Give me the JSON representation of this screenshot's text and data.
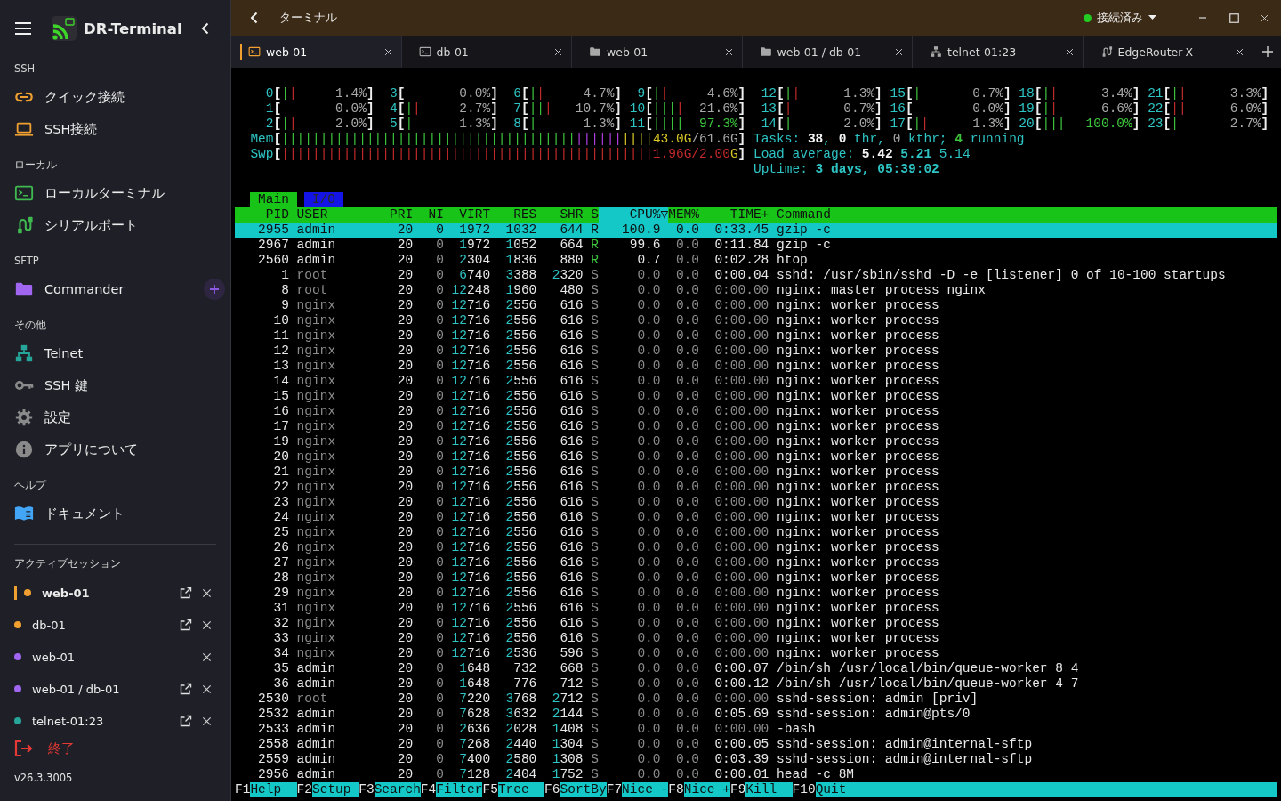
{
  "sidebar": {
    "app_name": "DR-Terminal",
    "sections": [
      {
        "heading": "SSH",
        "items": [
          {
            "label": "クイック接続",
            "kind": "quick"
          },
          {
            "label": "SSH接続",
            "kind": "ssh"
          }
        ]
      },
      {
        "heading": "ローカル",
        "items": [
          {
            "label": "ローカルターミナル",
            "kind": "local"
          },
          {
            "label": "シリアルポート",
            "kind": "serial"
          }
        ]
      },
      {
        "heading": "SFTP",
        "items": [
          {
            "label": "Commander",
            "kind": "sftp",
            "add_button": true
          }
        ]
      },
      {
        "heading": "その他",
        "items": [
          {
            "label": "Telnet",
            "kind": "telnet"
          },
          {
            "label": "SSH 鍵",
            "kind": "keys"
          },
          {
            "label": "設定",
            "kind": "settings"
          },
          {
            "label": "アプリについて",
            "kind": "about"
          }
        ]
      },
      {
        "heading": "ヘルプ",
        "items": [
          {
            "label": "ドキュメント",
            "kind": "docs"
          }
        ]
      }
    ],
    "sessions_heading": "アクティブセッション",
    "sessions": [
      {
        "label": "web-01",
        "color": "#f0a030",
        "selected": true,
        "popout": true
      },
      {
        "label": "db-01",
        "color": "#f0a030",
        "selected": false,
        "popout": true
      },
      {
        "label": "web-01",
        "color": "#a066f0",
        "selected": false,
        "popout": false
      },
      {
        "label": "web-01 / db-01",
        "color": "#a066f0",
        "selected": false,
        "popout": true
      },
      {
        "label": "telnet-01:23",
        "color": "#26a69a",
        "selected": false,
        "popout": true
      }
    ],
    "exit": "終了",
    "version": "v26.3.3005"
  },
  "titlebar": {
    "title": "ターミナル",
    "status": {
      "label": "接続済み",
      "connected": true
    }
  },
  "tabs": [
    {
      "label": "web-01",
      "kind": "ssh",
      "selected": true
    },
    {
      "label": "db-01",
      "kind": "ssh",
      "selected": false
    },
    {
      "label": "web-01",
      "kind": "sftp",
      "selected": false
    },
    {
      "label": "web-01 / db-01",
      "kind": "sftp",
      "selected": false
    },
    {
      "label": "telnet-01:23",
      "kind": "telnet",
      "selected": false
    },
    {
      "label": "EdgeRouter-X",
      "kind": "serial",
      "selected": false
    }
  ],
  "terminal": {
    "left_cpus": [
      {
        "label": "0",
        "open": "[",
        "bar": [
          {
            "kind": "user",
            "text": "|"
          },
          {
            "kind": "kernel",
            "text": "|"
          }
        ],
        "value": [
          {
            "kind": "dim",
            "text": "1.4%"
          }
        ],
        "close": "]"
      },
      {
        "label": "1",
        "open": "[",
        "value": [
          {
            "kind": "dim",
            "text": "0.0%"
          }
        ],
        "close": "]"
      },
      {
        "label": "2",
        "open": "[",
        "bar": [
          {
            "kind": "user",
            "text": "|"
          },
          {
            "kind": "kernel",
            "text": "|"
          }
        ],
        "value": [
          {
            "kind": "dim",
            "text": "2.0%"
          }
        ],
        "close": "]"
      },
      {
        "label": "3",
        "open": "[",
        "value": [
          {
            "kind": "dim",
            "text": "0.0%"
          }
        ],
        "close": "]"
      },
      {
        "label": "4",
        "open": "[",
        "bar": [
          {
            "kind": "user",
            "text": "|"
          },
          {
            "kind": "kernel",
            "text": "|"
          }
        ],
        "value": [
          {
            "kind": "dim",
            "text": "2.7%"
          }
        ],
        "close": "]"
      },
      {
        "label": "5",
        "open": "[",
        "bar": [
          {
            "kind": "user",
            "text": "|"
          }
        ],
        "value": [
          {
            "kind": "dim",
            "text": "1.3%"
          }
        ],
        "close": "]"
      },
      {
        "label": "6",
        "open": "[",
        "bar": [
          {
            "kind": "user",
            "text": "|"
          },
          {
            "kind": "kernel",
            "text": "|"
          }
        ],
        "value": [
          {
            "kind": "dim",
            "text": "4.7%"
          }
        ],
        "close": "]"
      },
      {
        "label": "7",
        "open": "[",
        "bar": [
          {
            "kind": "user",
            "text": "||"
          },
          {
            "kind": "kernel",
            "text": "|"
          }
        ],
        "value": [
          {
            "kind": "dim",
            "text": "10.7%"
          }
        ],
        "close": "]"
      },
      {
        "label": "8",
        "open": "[",
        "bar": [
          {
            "kind": "user",
            "text": "|"
          }
        ],
        "value": [
          {
            "kind": "dim",
            "text": "1.3%"
          }
        ],
        "close": "]"
      },
      {
        "label": "9",
        "open": "[",
        "bar": [
          {
            "kind": "user",
            "text": "|"
          },
          {
            "kind": "kernel",
            "text": "|"
          }
        ],
        "value": [
          {
            "kind": "dim",
            "text": "4.6%"
          }
        ],
        "close": "]"
      },
      {
        "label": "10",
        "open": "[",
        "bar": [
          {
            "kind": "user",
            "text": "|||"
          },
          {
            "kind": "kernel",
            "text": "|"
          }
        ],
        "value": [
          {
            "kind": "dim",
            "text": "21.6%"
          }
        ],
        "close": "]"
      },
      {
        "label": "11",
        "open": "[",
        "bar": [
          {
            "kind": "user",
            "text": "||||"
          }
        ],
        "value": [
          {
            "kind": "user",
            "text": "97.3%"
          }
        ],
        "close": "]"
      }
    ],
    "right_cpus": [
      {
        "label": "12",
        "open": "[",
        "bar": [
          {
            "kind": "user",
            "text": "|"
          },
          {
            "kind": "kernel",
            "text": "|"
          }
        ],
        "value": [
          {
            "kind": "dim",
            "text": "1.3%"
          }
        ],
        "close": "]"
      },
      {
        "label": "13",
        "open": "[",
        "bar": [
          {
            "kind": "kernel",
            "text": "|"
          }
        ],
        "value": [
          {
            "kind": "dim",
            "text": "0.7%"
          }
        ],
        "close": "]"
      },
      {
        "label": "14",
        "open": "[",
        "bar": [
          {
            "kind": "user",
            "text": "|"
          }
        ],
        "value": [
          {
            "kind": "dim",
            "text": "2.0%"
          }
        ],
        "close": "]"
      },
      {
        "label": "15",
        "open": "[",
        "bar": [
          {
            "kind": "user",
            "text": "|"
          }
        ],
        "value": [
          {
            "kind": "dim",
            "text": "0.7%"
          }
        ],
        "close": "]"
      },
      {
        "label": "16",
        "open": "[",
        "value": [
          {
            "kind": "dim",
            "text": "0.0%"
          }
        ],
        "close": "]"
      },
      {
        "label": "17",
        "open": "[",
        "bar": [
          {
            "kind": "user",
            "text": "|"
          },
          {
            "kind": "kernel",
            "text": "|"
          }
        ],
        "value": [
          {
            "kind": "dim",
            "text": "1.3%"
          }
        ],
        "close": "]"
      },
      {
        "label": "18",
        "open": "[",
        "bar": [
          {
            "kind": "user",
            "text": "|"
          },
          {
            "kind": "kernel",
            "text": "|"
          }
        ],
        "value": [
          {
            "kind": "dim",
            "text": "3.4%"
          }
        ],
        "close": "]"
      },
      {
        "label": "19",
        "open": "[",
        "bar": [
          {
            "kind": "user",
            "text": "|"
          },
          {
            "kind": "kernel",
            "text": "|"
          }
        ],
        "value": [
          {
            "kind": "dim",
            "text": "6.6%"
          }
        ],
        "close": "]"
      },
      {
        "label": "20",
        "open": "[",
        "bar": [
          {
            "kind": "user",
            "text": "|||"
          }
        ],
        "value": [
          {
            "kind": "user",
            "text": "100.0%"
          }
        ],
        "close": "]"
      },
      {
        "label": "21",
        "open": "[",
        "bar": [
          {
            "kind": "user",
            "text": "|"
          },
          {
            "kind": "kernel",
            "text": "|"
          }
        ],
        "value": [
          {
            "kind": "dim",
            "text": "3.3%"
          }
        ],
        "close": "]"
      },
      {
        "label": "22",
        "open": "[",
        "bar": [
          {
            "kind": "kernel",
            "text": "||"
          }
        ],
        "value": [
          {
            "kind": "dim",
            "text": "6.0%"
          }
        ],
        "close": "]"
      },
      {
        "label": "23",
        "open": "[",
        "bar": [
          {
            "kind": "user",
            "text": "|"
          }
        ],
        "value": [
          {
            "kind": "dim",
            "text": "2.7%"
          }
        ],
        "close": "]"
      }
    ],
    "left_meters": [
      {
        "label": "Mem",
        "open": "[",
        "bar": [
          {
            "kind": "user",
            "text": "||||||||||||||||||||||||||||||||||||||"
          },
          {
            "kind": "buffers",
            "text": "||||||"
          },
          {
            "kind": "cache",
            "text": "||||"
          }
        ],
        "value": [
          {
            "kind": "cache",
            "text": "43.0G"
          },
          {
            "kind": "dim",
            "text": "/61.6G"
          }
        ],
        "close": "]"
      },
      {
        "label": "Swp",
        "open": "[",
        "bar": [
          {
            "kind": "swap",
            "text": "||||||||||||||||||||||||||||||||||||||||||||||||"
          }
        ],
        "value": [
          {
            "kind": "swap",
            "text": "1.96G/2.00"
          },
          {
            "kind": "cache",
            "text": "G"
          }
        ],
        "close": "]"
      }
    ],
    "right_lines": [
      [
        {
          "kind": "info",
          "text": "Tasks: "
        },
        {
          "kind": "strong",
          "text": "38"
        },
        {
          "kind": "info",
          "text": ", "
        },
        {
          "kind": "strong",
          "text": "0"
        },
        {
          "kind": "info",
          "text": " thr, "
        },
        {
          "kind": "faint",
          "text": "0"
        },
        {
          "kind": "info",
          "text": " kthr; "
        },
        {
          "kind": "ok",
          "text": "4"
        },
        {
          "kind": "info",
          "text": " running"
        }
      ],
      [
        {
          "kind": "info",
          "text": "Load average: "
        },
        {
          "kind": "strong",
          "text": "5.42 "
        },
        {
          "kind": "info_bold",
          "text": "5.21 "
        },
        {
          "kind": "info",
          "text": "5.14"
        }
      ],
      [
        {
          "kind": "info",
          "text": "Uptime: "
        },
        {
          "kind": "info_bold",
          "text": "3 days, 05:39:02"
        }
      ]
    ],
    "screens": [
      {
        "label": "Main",
        "selected": true
      },
      {
        "label": "I/O",
        "selected": false
      }
    ],
    "columns": [
      {
        "label": "PID",
        "sorted": false
      },
      {
        "label": "USER",
        "sorted": false
      },
      {
        "label": "PRI",
        "sorted": false
      },
      {
        "label": "NI",
        "sorted": false
      },
      {
        "label": "VIRT",
        "sorted": false
      },
      {
        "label": "RES",
        "sorted": false
      },
      {
        "label": "SHR",
        "sorted": false
      },
      {
        "label": "S",
        "sorted": false
      },
      {
        "label": "CPU%▽",
        "sorted": true
      },
      {
        "label": "MEM%",
        "sorted": false
      },
      {
        "label": "TIME+",
        "sorted": false
      },
      {
        "label": "Command",
        "sorted": false
      }
    ],
    "rows": [
      {
        "pid": "2955",
        "user": "admin",
        "pri": "20",
        "ni": "0",
        "virt": "1972",
        "res": "1032",
        "shr": "644",
        "s": "R",
        "cpu": "100.9",
        "mem": "0.0",
        "time": "0:33.45",
        "command": "gzip -c",
        "selected": true
      },
      {
        "pid": "2967",
        "user": "admin",
        "pri": "20",
        "ni": "0",
        "virt": "1972",
        "res": "1052",
        "shr": "664",
        "s": "R",
        "cpu": "99.6",
        "mem": "0.0",
        "time": "0:11.84",
        "command": "gzip -c",
        "selected": false,
        "own": true,
        "running": true,
        "cpu_idle": false,
        "time_idle": false
      },
      {
        "pid": "2560",
        "user": "admin",
        "pri": "20",
        "ni": "0",
        "virt": "2304",
        "res": "1836",
        "shr": "880",
        "s": "R",
        "cpu": "0.7",
        "mem": "0.0",
        "time": "0:02.28",
        "command": "htop",
        "selected": false,
        "own": true,
        "running": true,
        "cpu_idle": false,
        "time_idle": false
      },
      {
        "pid": "1",
        "user": "root",
        "pri": "20",
        "ni": "0",
        "virt": "6740",
        "res": "3388",
        "shr": "2320",
        "s": "S",
        "cpu": "0.0",
        "mem": "0.0",
        "time": "0:00.04",
        "command": "sshd: /usr/sbin/sshd -D -e [listener] 0 of 10-100 startups",
        "selected": false,
        "own": false,
        "running": false,
        "cpu_idle": true,
        "time_idle": false
      },
      {
        "pid": "8",
        "user": "root",
        "pri": "20",
        "ni": "0",
        "virt": "12248",
        "res": "1960",
        "shr": "480",
        "s": "S",
        "cpu": "0.0",
        "mem": "0.0",
        "time": "0:00.00",
        "command": "nginx: master process nginx",
        "selected": false,
        "own": false,
        "running": false,
        "cpu_idle": true,
        "time_idle": true
      },
      {
        "pid": "9",
        "user": "nginx",
        "pri": "20",
        "ni": "0",
        "virt": "12716",
        "res": "2556",
        "shr": "616",
        "s": "S",
        "cpu": "0.0",
        "mem": "0.0",
        "time": "0:00.00",
        "command": "nginx: worker process",
        "selected": false,
        "own": false,
        "running": false,
        "cpu_idle": true,
        "time_idle": true
      },
      {
        "pid": "10",
        "user": "nginx",
        "pri": "20",
        "ni": "0",
        "virt": "12716",
        "res": "2556",
        "shr": "616",
        "s": "S",
        "cpu": "0.0",
        "mem": "0.0",
        "time": "0:00.00",
        "command": "nginx: worker process",
        "selected": false,
        "own": false,
        "running": false,
        "cpu_idle": true,
        "time_idle": true
      },
      {
        "pid": "11",
        "user": "nginx",
        "pri": "20",
        "ni": "0",
        "virt": "12716",
        "res": "2556",
        "shr": "616",
        "s": "S",
        "cpu": "0.0",
        "mem": "0.0",
        "time": "0:00.00",
        "command": "nginx: worker process",
        "selected": false,
        "own": false,
        "running": false,
        "cpu_idle": true,
        "time_idle": true
      },
      {
        "pid": "12",
        "user": "nginx",
        "pri": "20",
        "ni": "0",
        "virt": "12716",
        "res": "2556",
        "shr": "616",
        "s": "S",
        "cpu": "0.0",
        "mem": "0.0",
        "time": "0:00.00",
        "command": "nginx: worker process",
        "selected": false,
        "own": false,
        "running": false,
        "cpu_idle": true,
        "time_idle": true
      },
      {
        "pid": "13",
        "user": "nginx",
        "pri": "20",
        "ni": "0",
        "virt": "12716",
        "res": "2556",
        "shr": "616",
        "s": "S",
        "cpu": "0.0",
        "mem": "0.0",
        "time": "0:00.00",
        "command": "nginx: worker process",
        "selected": false,
        "own": false,
        "running": false,
        "cpu_idle": true,
        "time_idle": true
      },
      {
        "pid": "14",
        "user": "nginx",
        "pri": "20",
        "ni": "0",
        "virt": "12716",
        "res": "2556",
        "shr": "616",
        "s": "S",
        "cpu": "0.0",
        "mem": "0.0",
        "time": "0:00.00",
        "command": "nginx: worker process",
        "selected": false,
        "own": false,
        "running": false,
        "cpu_idle": true,
        "time_idle": true
      },
      {
        "pid": "15",
        "user": "nginx",
        "pri": "20",
        "ni": "0",
        "virt": "12716",
        "res": "2556",
        "shr": "616",
        "s": "S",
        "cpu": "0.0",
        "mem": "0.0",
        "time": "0:00.00",
        "command": "nginx: worker process",
        "selected": false,
        "own": false,
        "running": false,
        "cpu_idle": true,
        "time_idle": true
      },
      {
        "pid": "16",
        "user": "nginx",
        "pri": "20",
        "ni": "0",
        "virt": "12716",
        "res": "2556",
        "shr": "616",
        "s": "S",
        "cpu": "0.0",
        "mem": "0.0",
        "time": "0:00.00",
        "command": "nginx: worker process",
        "selected": false,
        "own": false,
        "running": false,
        "cpu_idle": true,
        "time_idle": true
      },
      {
        "pid": "17",
        "user": "nginx",
        "pri": "20",
        "ni": "0",
        "virt": "12716",
        "res": "2556",
        "shr": "616",
        "s": "S",
        "cpu": "0.0",
        "mem": "0.0",
        "time": "0:00.00",
        "command": "nginx: worker process",
        "selected": false,
        "own": false,
        "running": false,
        "cpu_idle": true,
        "time_idle": true
      },
      {
        "pid": "19",
        "user": "nginx",
        "pri": "20",
        "ni": "0",
        "virt": "12716",
        "res": "2556",
        "shr": "616",
        "s": "S",
        "cpu": "0.0",
        "mem": "0.0",
        "time": "0:00.00",
        "command": "nginx: worker process",
        "selected": false,
        "own": false,
        "running": false,
        "cpu_idle": true,
        "time_idle": true
      },
      {
        "pid": "20",
        "user": "nginx",
        "pri": "20",
        "ni": "0",
        "virt": "12716",
        "res": "2556",
        "shr": "616",
        "s": "S",
        "cpu": "0.0",
        "mem": "0.0",
        "time": "0:00.00",
        "command": "nginx: worker process",
        "selected": false,
        "own": false,
        "running": false,
        "cpu_idle": true,
        "time_idle": true
      },
      {
        "pid": "21",
        "user": "nginx",
        "pri": "20",
        "ni": "0",
        "virt": "12716",
        "res": "2556",
        "shr": "616",
        "s": "S",
        "cpu": "0.0",
        "mem": "0.0",
        "time": "0:00.00",
        "command": "nginx: worker process",
        "selected": false,
        "own": false,
        "running": false,
        "cpu_idle": true,
        "time_idle": true
      },
      {
        "pid": "22",
        "user": "nginx",
        "pri": "20",
        "ni": "0",
        "virt": "12716",
        "res": "2556",
        "shr": "616",
        "s": "S",
        "cpu": "0.0",
        "mem": "0.0",
        "time": "0:00.00",
        "command": "nginx: worker process",
        "selected": false,
        "own": false,
        "running": false,
        "cpu_idle": true,
        "time_idle": true
      },
      {
        "pid": "23",
        "user": "nginx",
        "pri": "20",
        "ni": "0",
        "virt": "12716",
        "res": "2556",
        "shr": "616",
        "s": "S",
        "cpu": "0.0",
        "mem": "0.0",
        "time": "0:00.00",
        "command": "nginx: worker process",
        "selected": false,
        "own": false,
        "running": false,
        "cpu_idle": true,
        "time_idle": true
      },
      {
        "pid": "24",
        "user": "nginx",
        "pri": "20",
        "ni": "0",
        "virt": "12716",
        "res": "2556",
        "shr": "616",
        "s": "S",
        "cpu": "0.0",
        "mem": "0.0",
        "time": "0:00.00",
        "command": "nginx: worker process",
        "selected": false,
        "own": false,
        "running": false,
        "cpu_idle": true,
        "time_idle": true
      },
      {
        "pid": "25",
        "user": "nginx",
        "pri": "20",
        "ni": "0",
        "virt": "12716",
        "res": "2556",
        "shr": "616",
        "s": "S",
        "cpu": "0.0",
        "mem": "0.0",
        "time": "0:00.00",
        "command": "nginx: worker process",
        "selected": false,
        "own": false,
        "running": false,
        "cpu_idle": true,
        "time_idle": true
      },
      {
        "pid": "26",
        "user": "nginx",
        "pri": "20",
        "ni": "0",
        "virt": "12716",
        "res": "2556",
        "shr": "616",
        "s": "S",
        "cpu": "0.0",
        "mem": "0.0",
        "time": "0:00.00",
        "command": "nginx: worker process",
        "selected": false,
        "own": false,
        "running": false,
        "cpu_idle": true,
        "time_idle": true
      },
      {
        "pid": "27",
        "user": "nginx",
        "pri": "20",
        "ni": "0",
        "virt": "12716",
        "res": "2556",
        "shr": "616",
        "s": "S",
        "cpu": "0.0",
        "mem": "0.0",
        "time": "0:00.00",
        "command": "nginx: worker process",
        "selected": false,
        "own": false,
        "running": false,
        "cpu_idle": true,
        "time_idle": true
      },
      {
        "pid": "28",
        "user": "nginx",
        "pri": "20",
        "ni": "0",
        "virt": "12716",
        "res": "2556",
        "shr": "616",
        "s": "S",
        "cpu": "0.0",
        "mem": "0.0",
        "time": "0:00.00",
        "command": "nginx: worker process",
        "selected": false,
        "own": false,
        "running": false,
        "cpu_idle": true,
        "time_idle": true
      },
      {
        "pid": "29",
        "user": "nginx",
        "pri": "20",
        "ni": "0",
        "virt": "12716",
        "res": "2556",
        "shr": "616",
        "s": "S",
        "cpu": "0.0",
        "mem": "0.0",
        "time": "0:00.00",
        "command": "nginx: worker process",
        "selected": false,
        "own": false,
        "running": false,
        "cpu_idle": true,
        "time_idle": true
      },
      {
        "pid": "31",
        "user": "nginx",
        "pri": "20",
        "ni": "0",
        "virt": "12716",
        "res": "2556",
        "shr": "616",
        "s": "S",
        "cpu": "0.0",
        "mem": "0.0",
        "time": "0:00.00",
        "command": "nginx: worker process",
        "selected": false,
        "own": false,
        "running": false,
        "cpu_idle": true,
        "time_idle": true
      },
      {
        "pid": "32",
        "user": "nginx",
        "pri": "20",
        "ni": "0",
        "virt": "12716",
        "res": "2556",
        "shr": "616",
        "s": "S",
        "cpu": "0.0",
        "mem": "0.0",
        "time": "0:00.00",
        "command": "nginx: worker process",
        "selected": false,
        "own": false,
        "running": false,
        "cpu_idle": true,
        "time_idle": true
      },
      {
        "pid": "33",
        "user": "nginx",
        "pri": "20",
        "ni": "0",
        "virt": "12716",
        "res": "2556",
        "shr": "616",
        "s": "S",
        "cpu": "0.0",
        "mem": "0.0",
        "time": "0:00.00",
        "command": "nginx: worker process",
        "selected": false,
        "own": false,
        "running": false,
        "cpu_idle": true,
        "time_idle": true
      },
      {
        "pid": "34",
        "user": "nginx",
        "pri": "20",
        "ni": "0",
        "virt": "12716",
        "res": "2536",
        "shr": "596",
        "s": "S",
        "cpu": "0.0",
        "mem": "0.0",
        "time": "0:00.00",
        "command": "nginx: worker process",
        "selected": false,
        "own": false,
        "running": false,
        "cpu_idle": true,
        "time_idle": true
      },
      {
        "pid": "35",
        "user": "admin",
        "pri": "20",
        "ni": "0",
        "virt": "1648",
        "res": "732",
        "shr": "668",
        "s": "S",
        "cpu": "0.0",
        "mem": "0.0",
        "time": "0:00.07",
        "command": "/bin/sh /usr/local/bin/queue-worker 8 4",
        "selected": false,
        "own": true,
        "running": false,
        "cpu_idle": true,
        "time_idle": false
      },
      {
        "pid": "36",
        "user": "admin",
        "pri": "20",
        "ni": "0",
        "virt": "1648",
        "res": "776",
        "shr": "712",
        "s": "S",
        "cpu": "0.0",
        "mem": "0.0",
        "time": "0:00.12",
        "command": "/bin/sh /usr/local/bin/queue-worker 4 7",
        "selected": false,
        "own": true,
        "running": false,
        "cpu_idle": true,
        "time_idle": false
      },
      {
        "pid": "2530",
        "user": "root",
        "pri": "20",
        "ni": "0",
        "virt": "7220",
        "res": "3768",
        "shr": "2712",
        "s": "S",
        "cpu": "0.0",
        "mem": "0.0",
        "time": "0:00.00",
        "command": "sshd-session: admin [priv]",
        "selected": false,
        "own": false,
        "running": false,
        "cpu_idle": true,
        "time_idle": true
      },
      {
        "pid": "2532",
        "user": "admin",
        "pri": "20",
        "ni": "0",
        "virt": "7628",
        "res": "3632",
        "shr": "2144",
        "s": "S",
        "cpu": "0.0",
        "mem": "0.0",
        "time": "0:05.69",
        "command": "sshd-session: admin@pts/0",
        "selected": false,
        "own": true,
        "running": false,
        "cpu_idle": true,
        "time_idle": false
      },
      {
        "pid": "2533",
        "user": "admin",
        "pri": "20",
        "ni": "0",
        "virt": "2636",
        "res": "2028",
        "shr": "1408",
        "s": "S",
        "cpu": "0.0",
        "mem": "0.0",
        "time": "0:00.00",
        "command": "-bash",
        "selected": false,
        "own": true,
        "running": false,
        "cpu_idle": true,
        "time_idle": true
      },
      {
        "pid": "2558",
        "user": "admin",
        "pri": "20",
        "ni": "0",
        "virt": "7268",
        "res": "2440",
        "shr": "1304",
        "s": "S",
        "cpu": "0.0",
        "mem": "0.0",
        "time": "0:00.05",
        "command": "sshd-session: admin@internal-sftp",
        "selected": false,
        "own": true,
        "running": false,
        "cpu_idle": true,
        "time_idle": false
      },
      {
        "pid": "2559",
        "user": "admin",
        "pri": "20",
        "ni": "0",
        "virt": "7400",
        "res": "2580",
        "shr": "1308",
        "s": "S",
        "cpu": "0.0",
        "mem": "0.0",
        "time": "0:03.39",
        "command": "sshd-session: admin@internal-sftp",
        "selected": false,
        "own": true,
        "running": false,
        "cpu_idle": true,
        "time_idle": false
      },
      {
        "pid": "2956",
        "user": "admin",
        "pri": "20",
        "ni": "0",
        "virt": "7128",
        "res": "2404",
        "shr": "1752",
        "s": "S",
        "cpu": "0.0",
        "mem": "0.0",
        "time": "0:00.01",
        "command": "head -c 8M",
        "selected": false,
        "own": true,
        "running": false,
        "cpu_idle": true,
        "time_idle": false
      }
    ],
    "keys": [
      {
        "key": "F1",
        "label": "Help"
      },
      {
        "key": "F2",
        "label": "Setup"
      },
      {
        "key": "F3",
        "label": "Search"
      },
      {
        "key": "F4",
        "label": "Filter"
      },
      {
        "key": "F5",
        "label": "Tree"
      },
      {
        "key": "F6",
        "label": "SortBy"
      },
      {
        "key": "F7",
        "label": "Nice -"
      },
      {
        "key": "F8",
        "label": "Nice +"
      },
      {
        "key": "F9",
        "label": "Kill"
      },
      {
        "key": "F10",
        "label": "Quit"
      }
    ]
  }
}
